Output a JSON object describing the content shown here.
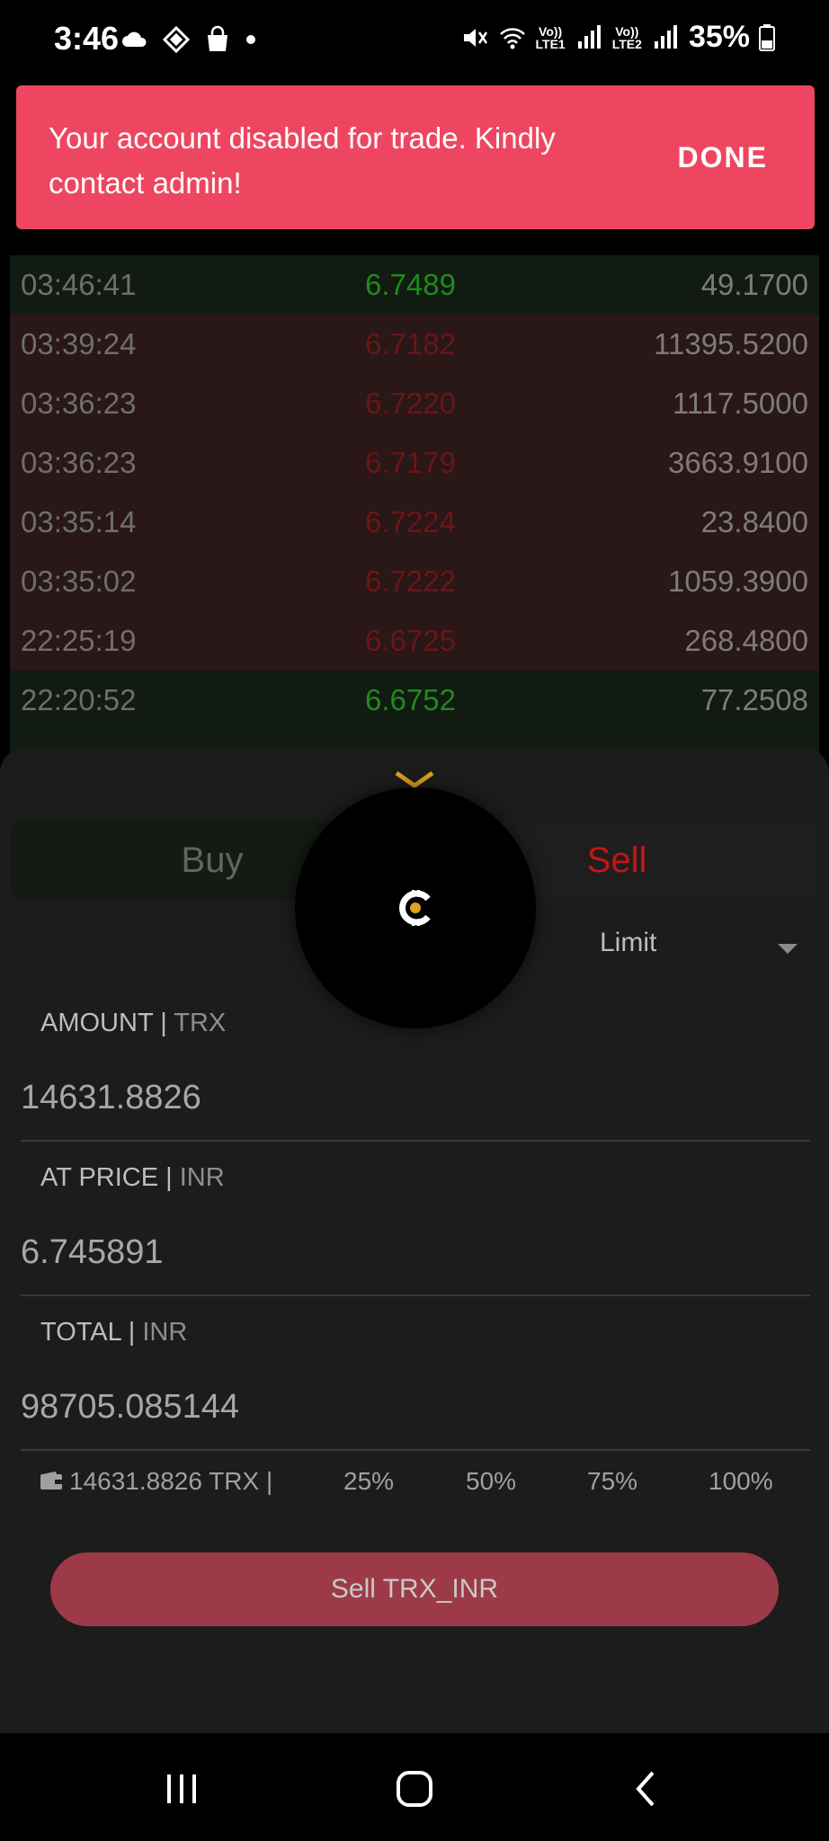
{
  "status_bar": {
    "time": "3:46",
    "battery": "35%",
    "left_icons": [
      "cloud-icon",
      "binance-icon",
      "shopping-bag-icon",
      "dot-icon"
    ],
    "right_icons": [
      "mute-icon",
      "wifi-icon",
      "volte-lte1-icon",
      "signal-icon",
      "volte-lte2-icon",
      "signal-icon",
      "battery-icon"
    ],
    "lte1": "LTE1",
    "lte2": "LTE2"
  },
  "toast": {
    "message": "Your account disabled for trade. Kindly contact admin!",
    "action": "DONE",
    "color": "#EE4660"
  },
  "trades": [
    {
      "time": "03:46:41",
      "price": "6.7489",
      "amount": "49.1700",
      "side": "buy"
    },
    {
      "time": "03:39:24",
      "price": "6.7182",
      "amount": "11395.5200",
      "side": "sell"
    },
    {
      "time": "03:36:23",
      "price": "6.7220",
      "amount": "1117.5000",
      "side": "sell"
    },
    {
      "time": "03:36:23",
      "price": "6.7179",
      "amount": "3663.9100",
      "side": "sell"
    },
    {
      "time": "03:35:14",
      "price": "6.7224",
      "amount": "23.8400",
      "side": "sell"
    },
    {
      "time": "03:35:02",
      "price": "6.7222",
      "amount": "1059.3900",
      "side": "sell"
    },
    {
      "time": "22:25:19",
      "price": "6.6725",
      "amount": "268.4800",
      "side": "sell"
    },
    {
      "time": "22:20:52",
      "price": "6.6752",
      "amount": "77.2508",
      "side": "buy"
    }
  ],
  "tabs": {
    "buy": "Buy",
    "sell": "Sell"
  },
  "order_type": {
    "selected": "Limit"
  },
  "amount": {
    "label": "AMOUNT",
    "unit": "TRX",
    "value": "14631.8826"
  },
  "price": {
    "label": "AT PRICE",
    "unit": "INR",
    "value": "6.745891"
  },
  "total": {
    "label": "TOTAL",
    "unit": "INR",
    "value": "98705.085144"
  },
  "balance": {
    "text": "14631.8826 TRX  |",
    "icon": "wallet-icon"
  },
  "percent_options": [
    "25%",
    "50%",
    "75%",
    "100%"
  ],
  "sell_button": "Sell TRX_INR",
  "colors": {
    "buy_green": "#1E8A1E",
    "sell_red": "#C41515",
    "button": "#9D3A48",
    "accent_gold": "#E0A020"
  }
}
